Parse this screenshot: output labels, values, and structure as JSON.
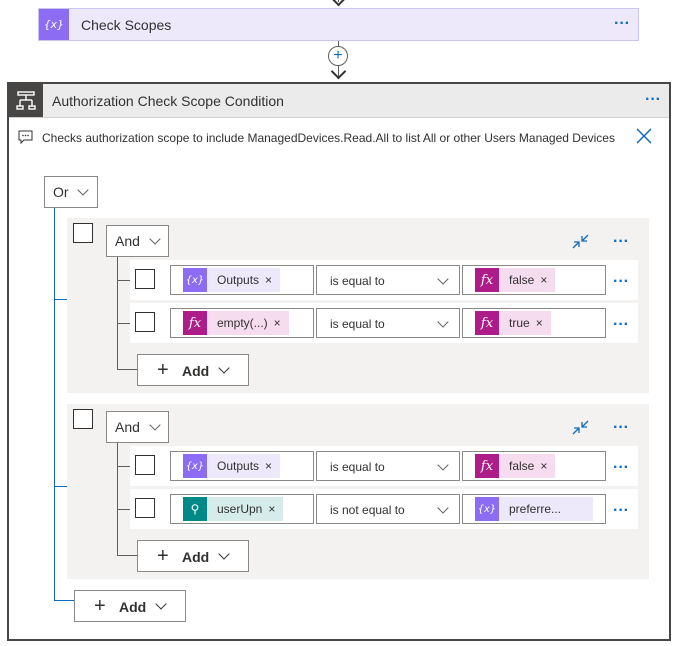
{
  "check_scopes": {
    "title": "Check Scopes",
    "icon": "variable-icon",
    "more": "···"
  },
  "connector": {
    "add_symbol": "+"
  },
  "condition": {
    "title": "Authorization Check Scope Condition",
    "more": "···",
    "description": "Checks authorization scope to include ManagedDevices.Read.All to list All or other Users Managed Devices",
    "root_operator": "Or",
    "groups": [
      {
        "operator": "And",
        "rows": [
          {
            "left": {
              "type": "var",
              "label": "Outputs"
            },
            "op": "is equal to",
            "right": {
              "type": "fx",
              "label": "false"
            }
          },
          {
            "left": {
              "type": "fx",
              "label": "empty(...)"
            },
            "op": "is equal to",
            "right": {
              "type": "fx",
              "label": "true"
            }
          }
        ],
        "add_label": "Add"
      },
      {
        "operator": "And",
        "rows": [
          {
            "left": {
              "type": "var",
              "label": "Outputs"
            },
            "op": "is equal to",
            "right": {
              "type": "fx",
              "label": "false"
            }
          },
          {
            "left": {
              "type": "user",
              "label": "userUpn"
            },
            "op": "is not equal to",
            "right": {
              "type": "var",
              "label": "preferre..."
            }
          }
        ],
        "add_label": "Add"
      }
    ],
    "add_label": "Add"
  },
  "glyphs": {
    "var": "{x}",
    "fx": "fx",
    "user": "⚲",
    "remove": "×",
    "dots": "···",
    "plus": "+"
  },
  "colors": {
    "accent": "#0f6cbd",
    "variable": "#8c6cf2",
    "expression": "#ae1c8a",
    "user": "#008a87"
  }
}
